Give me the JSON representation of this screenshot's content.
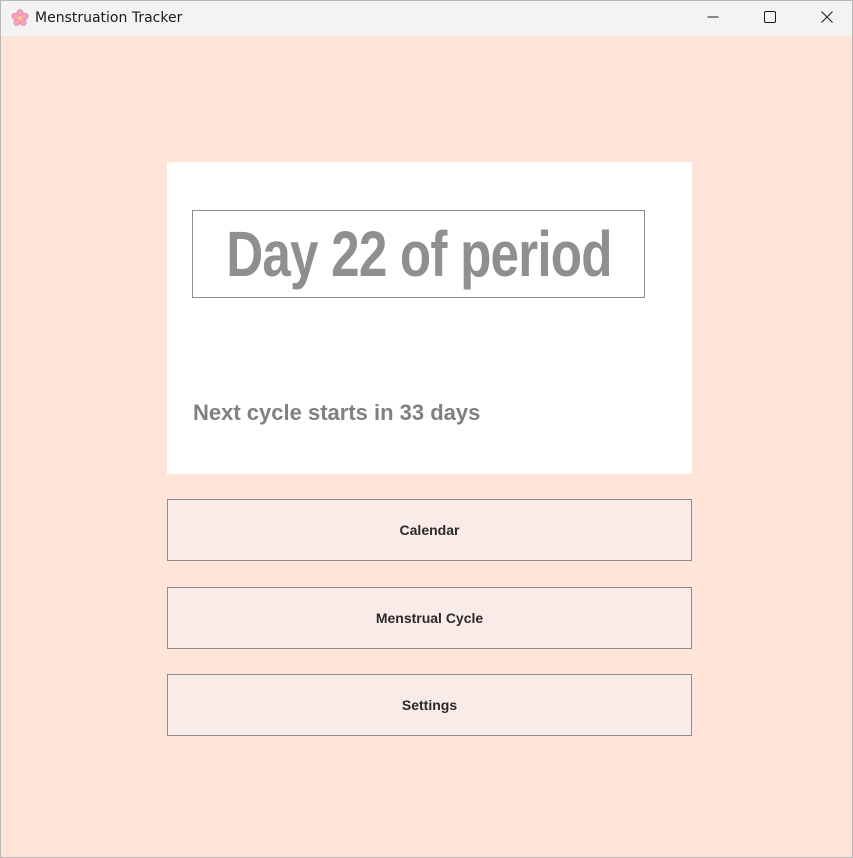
{
  "window": {
    "title": "Menstruation Tracker",
    "app_icon": "cherry-blossom-icon",
    "controls": {
      "minimize_icon": "minimize-icon",
      "maximize_icon": "maximize-icon",
      "close_icon": "close-icon"
    }
  },
  "status": {
    "day_text": "Day 22 of period",
    "next_cycle_text": "Next cycle starts in 33 days"
  },
  "menu": {
    "items": [
      {
        "label": "Calendar"
      },
      {
        "label": "Menstrual Cycle"
      },
      {
        "label": "Settings"
      }
    ]
  },
  "colors": {
    "background": "#ffe4da",
    "card": "#ffffff",
    "button_bg": "#f9ebe8",
    "muted_text": "#8f8f8f"
  }
}
